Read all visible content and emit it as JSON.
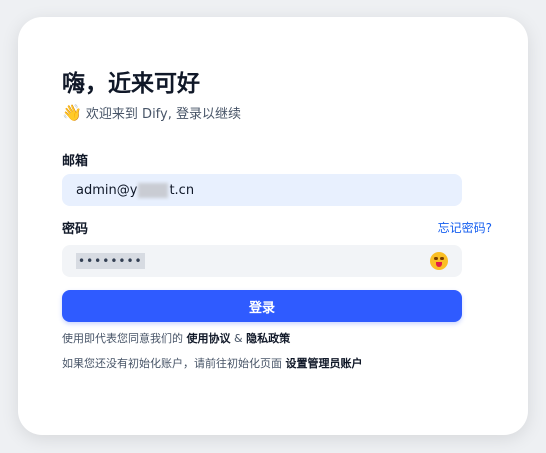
{
  "login": {
    "title": "嗨，近来可好",
    "subtitle_emoji": "👋",
    "subtitle": "欢迎来到 Dify, 登录以继续",
    "email_label": "邮箱",
    "email_value_prefix": "admin@y",
    "email_value_suffix": "t.cn",
    "password_label": "密码",
    "forgot_label": "忘记密码?",
    "password_masked": "••••••••",
    "show_password_icon": "tongue-out-face-icon",
    "submit_label": "登录",
    "terms_prefix": "使用即代表您同意我们的",
    "terms_link": "使用协议",
    "terms_and": "&",
    "privacy_link": "隐私政策",
    "setup_prefix": "如果您还没有初始化账户，请前往初始化页面",
    "setup_link": "设置管理员账户"
  },
  "colors": {
    "primary": "#2f5bff",
    "link": "#155eef",
    "email_bg": "#e8f0fe",
    "input_bg": "#f2f4f7"
  }
}
